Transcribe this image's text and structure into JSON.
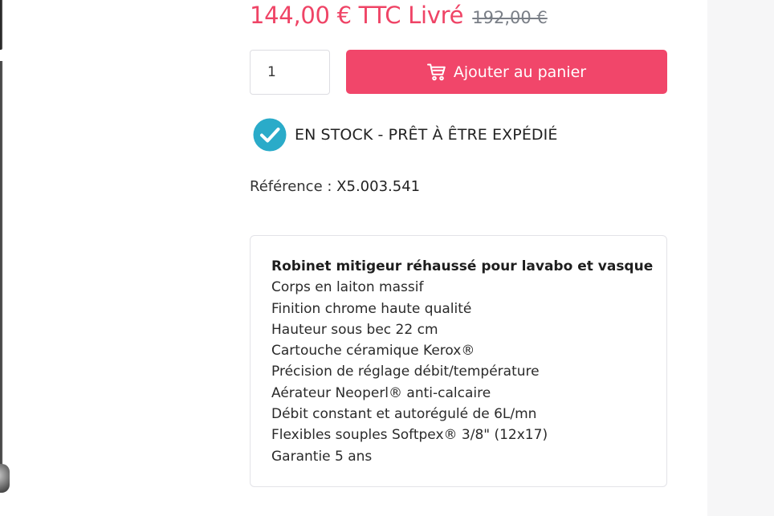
{
  "price": {
    "current": "144,00 € TTC Livré",
    "old": "192,00 €"
  },
  "quantity": {
    "value": "1"
  },
  "cart_button": {
    "label": "Ajouter au panier",
    "icon": "cart-icon"
  },
  "stock": {
    "icon": "check-circle-icon",
    "text": "EN STOCK - PRÊT À ÊTRE EXPÉDIÉ"
  },
  "reference": {
    "label": "Référence :",
    "value": "X5.003.541"
  },
  "description": {
    "title": "Robinet mitigeur réhaussé pour lavabo et vasque",
    "features": [
      "Corps en laiton massif",
      "Finition chrome haute qualité",
      "Hauteur sous bec 22 cm",
      "Cartouche céramique Kerox®",
      "Précision de réglage débit/température",
      "Aérateur Neoperl® anti-calcaire",
      "Débit constant et autorégulé de 6L/mn",
      "Flexibles souples Softpex® 3/8\" (12x17)",
      "Garantie 5 ans"
    ]
  },
  "colors": {
    "accent": "#f1466a",
    "price": "#ef4466",
    "check": "#2aabc9"
  }
}
